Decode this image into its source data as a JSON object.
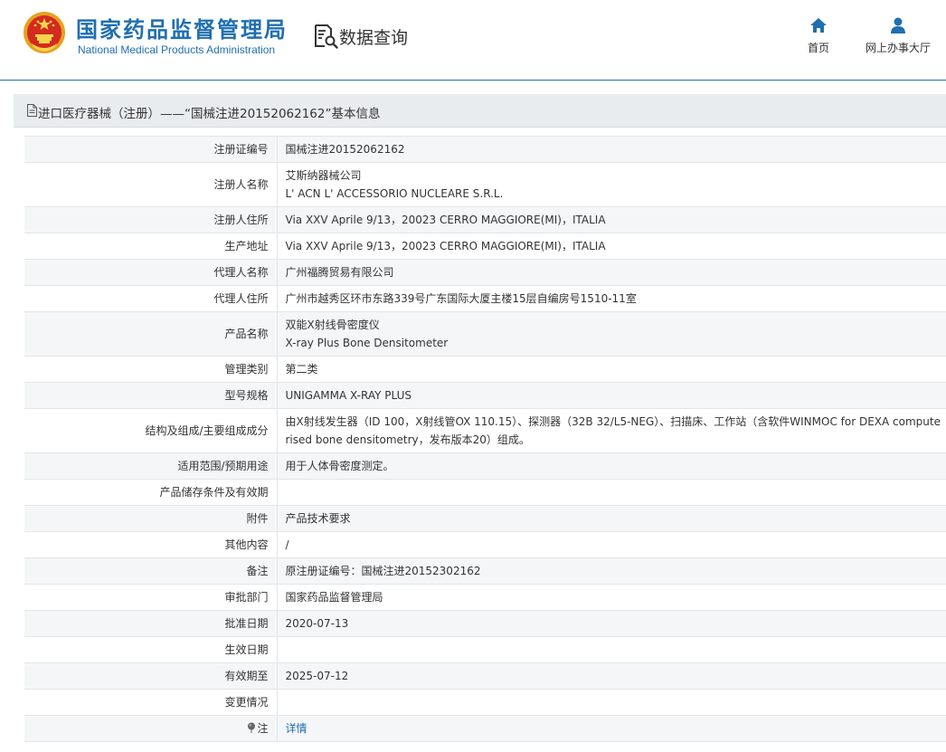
{
  "header": {
    "site_name_cn": "国家药品监督管理局",
    "site_name_en": "National Medical Products Administration",
    "query_title": "数据查询",
    "nav": [
      {
        "label": "首页",
        "icon": "home-icon"
      },
      {
        "label": "网上办事大厅",
        "icon": "user-icon"
      }
    ]
  },
  "panel": {
    "title": "进口医疗器械（注册）——“国械注进20152062162”基本信息",
    "icon": "document-icon"
  },
  "rows": [
    {
      "label": "注册证编号",
      "value": "国械注进20152062162"
    },
    {
      "label": "注册人名称",
      "value": "艾斯纳器械公司",
      "value2": "L' ACN L' ACCESSORIO NUCLEARE S.R.L."
    },
    {
      "label": "注册人住所",
      "value": "Via XXV Aprile 9/13，20023 CERRO MAGGIORE(MI)，ITALIA"
    },
    {
      "label": "生产地址",
      "value": "Via XXV Aprile 9/13，20023 CERRO MAGGIORE(MI)，ITALIA"
    },
    {
      "label": "代理人名称",
      "value": "广州福腾贸易有限公司"
    },
    {
      "label": "代理人住所",
      "value": "广州市越秀区环市东路339号广东国际大厦主楼15层自编房号1510-11室"
    },
    {
      "label": "产品名称",
      "value": "双能X射线骨密度仪",
      "value2": "X-ray Plus Bone Densitometer"
    },
    {
      "label": "管理类别",
      "value": "第二类"
    },
    {
      "label": "型号规格",
      "value": "UNIGAMMA X-RAY PLUS"
    },
    {
      "label": "结构及组成/主要组成成分",
      "value": "由X射线发生器（ID 100，X射线管OX 110.15）、探测器（32B 32/L5-NEG）、扫描床、工作站（含软件WINMOC for DEXA computerised bone densitometry，发布版本20）组成。"
    },
    {
      "label": "适用范围/预期用途",
      "value": "用于人体骨密度测定。"
    },
    {
      "label": "产品储存条件及有效期",
      "value": ""
    },
    {
      "label": "附件",
      "value": "产品技术要求"
    },
    {
      "label": "其他内容",
      "value": "/"
    },
    {
      "label": "备注",
      "value": "原注册证编号：国械注进20152302162"
    },
    {
      "label": "审批部门",
      "value": "国家药品监督管理局"
    },
    {
      "label": "批准日期",
      "value": "2020-07-13"
    },
    {
      "label": "生效日期",
      "value": ""
    },
    {
      "label": "有效期至",
      "value": "2025-07-12"
    },
    {
      "label": "变更情况",
      "value": ""
    },
    {
      "label": "注",
      "value": "详情",
      "icon": "pin-icon"
    }
  ],
  "colors": {
    "brand": "#1f6fb2",
    "title_bar": "#e9ecef",
    "row_stripe": "#f5f6f7",
    "link": "#1f6fb2"
  }
}
